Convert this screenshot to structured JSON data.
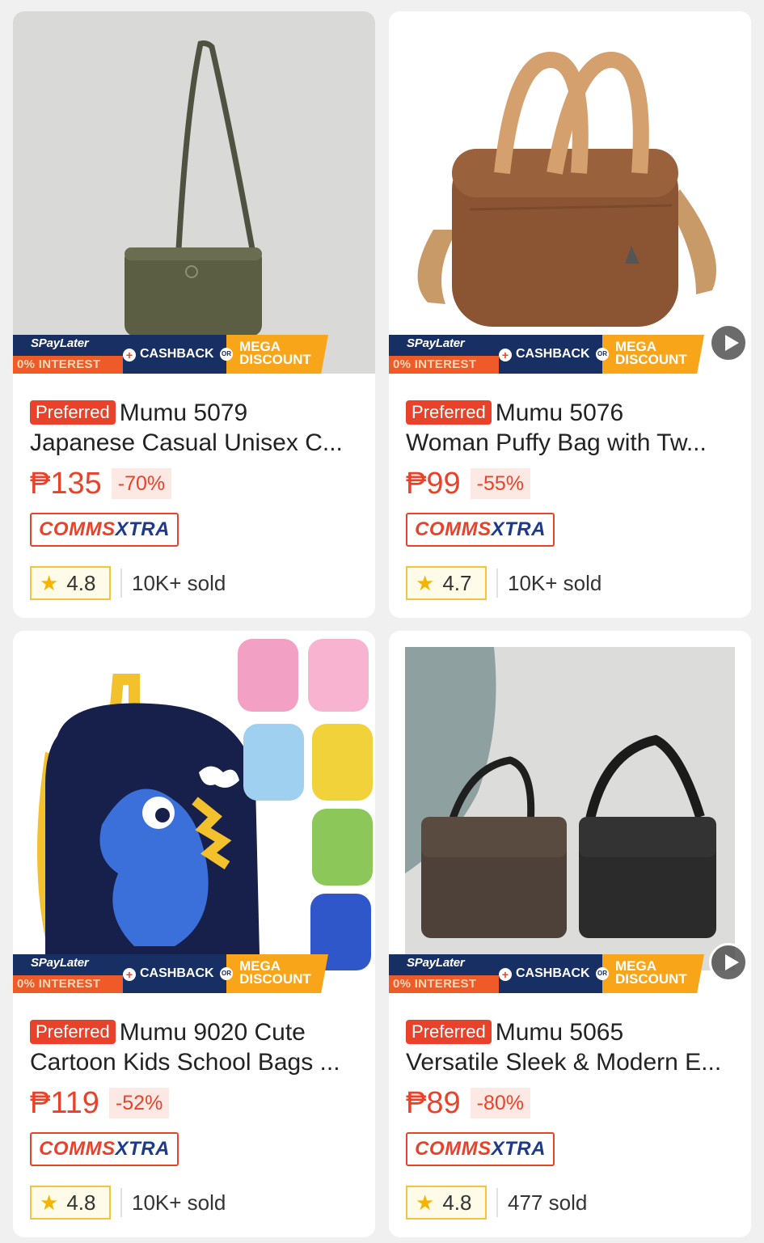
{
  "promo": {
    "spaylater": "SPayLater",
    "interest": "0% INTEREST",
    "cashback": "CASHBACK",
    "or": "OR",
    "mega1": "MEGA",
    "mega2": "DISCOUNT"
  },
  "badges": {
    "preferred": "Preferred",
    "comms_a": "COMMS",
    "comms_b": "XTRA"
  },
  "products": [
    {
      "line1": "Mumu 5079",
      "line2": "Japanese Casual Unisex C...",
      "price": "₱135",
      "discount": "-70%",
      "rating": "4.8",
      "sold": "10K+ sold",
      "has_video": false
    },
    {
      "line1": "Mumu 5076",
      "line2": "Woman Puffy Bag with Tw...",
      "price": "₱99",
      "discount": "-55%",
      "rating": "4.7",
      "sold": "10K+ sold",
      "has_video": true
    },
    {
      "line1": "Mumu 9020 Cute",
      "line2": "Cartoon Kids School Bags ...",
      "price": "₱119",
      "discount": "-52%",
      "rating": "4.8",
      "sold": "10K+ sold",
      "has_video": false
    },
    {
      "line1": "Mumu 5065",
      "line2": "Versatile Sleek & Modern E...",
      "price": "₱89",
      "discount": "-80%",
      "rating": "4.8",
      "sold": "477 sold",
      "has_video": true
    }
  ],
  "colors": {
    "brand": "#e8432a",
    "navy": "#172f63",
    "mega": "#f9a51a",
    "star": "#f5b400"
  }
}
